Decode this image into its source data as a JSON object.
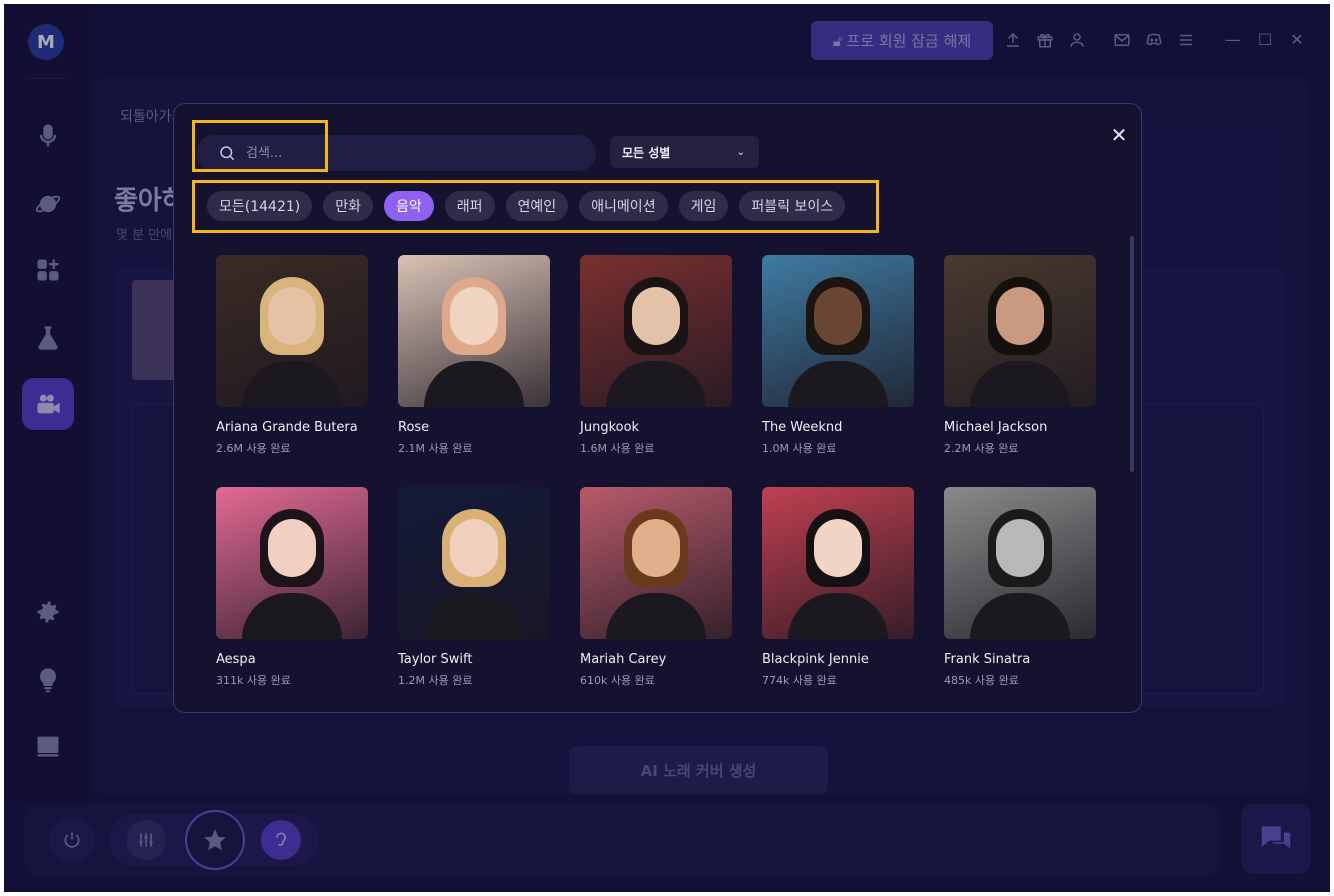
{
  "background": {
    "back_label": "되돌아가기",
    "title": "좋아하",
    "subtitle": "몇 분 만에",
    "generate_button": "AI 노래 커버 생성"
  },
  "topbar": {
    "pro_button": "프로 회원 잠금 해제",
    "icons": [
      "upload-icon",
      "gift-icon",
      "user-icon",
      "mail-icon",
      "discord-icon",
      "menu-icon"
    ],
    "window_controls": [
      "minimize-icon",
      "maximize-icon",
      "close-icon"
    ]
  },
  "sidebar": {
    "items": [
      "microphone-icon",
      "planet-icon",
      "apps-icon",
      "flask-icon",
      "video-icon",
      "settings-icon",
      "lightbulb-icon",
      "book-icon"
    ],
    "active": "video-icon"
  },
  "modal": {
    "search_placeholder": "검색...",
    "gender_select": "모든 성별",
    "tabs": [
      "모든(14421)",
      "만화",
      "음악",
      "래퍼",
      "연예인",
      "애니메이션",
      "게임",
      "퍼블릭 보이스"
    ],
    "active_tab": "음악",
    "voices": [
      {
        "name": "Ariana Grande Butera",
        "uses": "2.6M 사용 완료",
        "bg": "#3a2a24",
        "hair": "#d8b37c",
        "skin": "#e6c2a4"
      },
      {
        "name": "Rose",
        "uses": "2.1M 사용 완료",
        "bg": "#d9c2b4",
        "hair": "#e0a88a",
        "skin": "#f1d3c2"
      },
      {
        "name": "Jungkook",
        "uses": "1.6M 사용 완료",
        "bg": "#7a3030",
        "hair": "#1a1416",
        "skin": "#e2c2a8"
      },
      {
        "name": "The Weeknd",
        "uses": "1.0M 사용 완료",
        "bg": "#3f7ba2",
        "hair": "#1b1410",
        "skin": "#6a4634"
      },
      {
        "name": "Michael Jackson",
        "uses": "2.2M 사용 완료",
        "bg": "#4a3a2e",
        "hair": "#14100e",
        "skin": "#c99a80"
      },
      {
        "name": "Aespa",
        "uses": "311k 사용 완료",
        "bg": "#e26a94",
        "hair": "#1c1418",
        "skin": "#f0d0c0"
      },
      {
        "name": "Taylor Swift",
        "uses": "1.2M 사용 완료",
        "bg": "#141a3a",
        "hair": "#d9b076",
        "skin": "#f0d0bc"
      },
      {
        "name": "Mariah Carey",
        "uses": "610k 사용 완료",
        "bg": "#b85a6a",
        "hair": "#6a3a1c",
        "skin": "#e0b08c"
      },
      {
        "name": "Blackpink Jennie",
        "uses": "774k 사용 완료",
        "bg": "#c04050",
        "hair": "#141014",
        "skin": "#f2d4c4"
      },
      {
        "name": "Frank Sinatra",
        "uses": "485k 사용 완료",
        "bg": "#8a8a8a",
        "hair": "#1a1a1a",
        "skin": "#b8b8b8"
      }
    ]
  },
  "bottom": {
    "icons": [
      "power-icon",
      "equalizer-icon",
      "star-off-icon",
      "ear-icon",
      "chat-icon"
    ]
  },
  "colors": {
    "accent": "#8f61f0",
    "highlight": "#f2b51c",
    "window_bg": "#1a1546",
    "modal_bg": "#14122e"
  }
}
